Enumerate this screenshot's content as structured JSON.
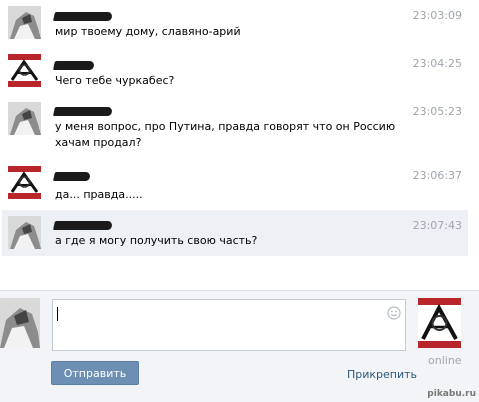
{
  "messages": [
    {
      "text": "мир твоему дому, славяно-арий",
      "time": "23:03:09",
      "avatar": "portrait-avatar"
    },
    {
      "text": "Чего тебе чуркабес?",
      "time": "23:04:25",
      "avatar": "emblem-avatar"
    },
    {
      "text": "у меня вопрос, про Путина, правда говорят что он Россию хачам продал?",
      "time": "23:05:23",
      "avatar": "portrait-avatar"
    },
    {
      "text": "да... правда.....",
      "time": "23:06:37",
      "avatar": "emblem-avatar"
    },
    {
      "text": "а где я могу получить свою часть?",
      "time": "23:07:43",
      "avatar": "portrait-avatar"
    }
  ],
  "compose": {
    "placeholder": "",
    "send_label": "Отправить",
    "attach_label": "Прикрепить",
    "emoji_icon": "smile-icon"
  },
  "peer": {
    "status": "online"
  },
  "watermark": "pikabu.ru",
  "colors": {
    "highlight": "#edf1f5",
    "button": "#6d8fb3",
    "link": "#2b587a",
    "timestamp": "#a0a6ad"
  }
}
